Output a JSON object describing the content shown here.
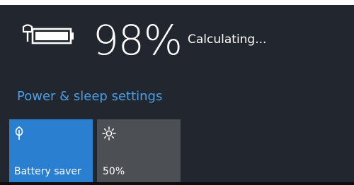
{
  "battery": {
    "percent_text": "98%",
    "status": "Calculating...",
    "icon": "battery-full-plugged-icon"
  },
  "link": {
    "label": "Power & sleep settings"
  },
  "quick_actions": [
    {
      "label": "Battery saver",
      "icon": "leaf-icon",
      "active": true
    },
    {
      "label": "50%",
      "icon": "brightness-icon",
      "active": false
    }
  ],
  "colors": {
    "panel_bg": "#22272f",
    "accent": "#2a7fd0",
    "link": "#4c9ee6",
    "tile_inactive": "#4c4f54"
  }
}
